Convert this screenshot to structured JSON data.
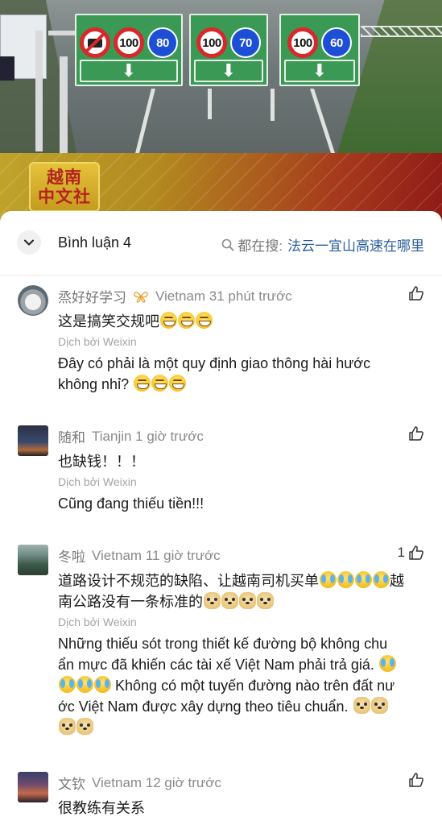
{
  "video": {
    "signs": [
      {
        "limits": [
          "100",
          "80"
        ],
        "no_truck": true
      },
      {
        "limits": [
          "100",
          "70"
        ],
        "no_truck": false
      },
      {
        "limits": [
          "100",
          "60"
        ],
        "no_truck": false
      }
    ],
    "arrow_glyph": "⬇",
    "logo_lines": [
      "越南",
      "中文社"
    ],
    "colors": {
      "sign_green": "#3a9a55",
      "disc_red": "#d8282b",
      "disc_blue": "#1d4fd6"
    }
  },
  "header": {
    "title": "Bình luận 4",
    "search_prefix": "都在搜:",
    "search_query": "法云一宜山高速在哪里",
    "icons": {
      "collapse": "chevron-down-icon",
      "search": "search-icon"
    }
  },
  "comments": [
    {
      "username": "烝好好学习",
      "has_badge": true,
      "meta": "Vietnam 31 phút trước",
      "likes": "",
      "original": "这是搞笑交规吧",
      "original_emojis": [
        "grin",
        "grin",
        "grin"
      ],
      "translated_by": "Dịch bởi Weixin",
      "translation_lines": [
        "Đây có phải là một quy định giao thông hài hước",
        "không nhỉ?"
      ],
      "translation_emojis": [
        "grin",
        "grin",
        "grin"
      ]
    },
    {
      "username": "随和",
      "has_badge": false,
      "meta": "Tianjin 1 giờ trước",
      "likes": "",
      "original": "也缺钱！！！",
      "original_emojis": [],
      "translated_by": "Dịch bởi Weixin",
      "translation_lines": [
        "Cũng đang thiếu tiền!!!"
      ],
      "translation_emojis": []
    },
    {
      "username": "冬啦",
      "has_badge": false,
      "meta": "Vietnam 11 giờ trước",
      "likes": "1",
      "original_line1": "道路设计不规范的缺陷、让越南司机买单",
      "original_line1_tail": "越",
      "original_line2": "南公路没有一条标准的",
      "translated_by": "Dịch bởi Weixin",
      "translation_line1": "Những thiếu sót trong thiết kế đường bộ không chu",
      "translation_line2": "ẩn mực đã khiến các tài xế Việt Nam phải trả giá.",
      "translation_line3": "Không có một tuyến đường nào trên đất nư",
      "translation_line4": "ớc Việt Nam được xây dựng theo tiêu chuẩn."
    },
    {
      "username": "文钦",
      "has_badge": false,
      "meta": "Vietnam 12 giờ trước",
      "likes": "",
      "original": "很教练有关系"
    }
  ]
}
